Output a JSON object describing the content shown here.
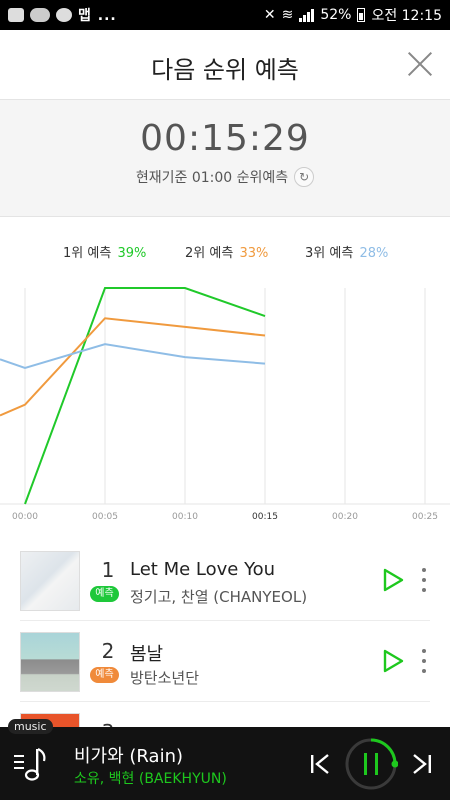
{
  "status_bar": {
    "left_text": "맵 ...",
    "battery": "52%",
    "time": "오전 12:15"
  },
  "header": {
    "title": "다음 순위 예측",
    "close_icon": "close-icon"
  },
  "timer": {
    "time": "00:15:29",
    "subtitle": "현재기준 01:00 순위예측"
  },
  "legend": [
    {
      "label": "1위 예측",
      "pct": "39%",
      "color": "#20c92a"
    },
    {
      "label": "2위 예측",
      "pct": "33%",
      "color": "#f09a3e"
    },
    {
      "label": "3위 예측",
      "pct": "28%",
      "color": "#8fbde6"
    }
  ],
  "chart_data": {
    "type": "line",
    "x": [
      "00:00",
      "00:05",
      "00:10",
      "00:15",
      "00:20",
      "00:25"
    ],
    "ylim": [
      0,
      100
    ],
    "grid": true,
    "series": [
      {
        "name": "1위 예측",
        "color": "#20c92a",
        "values": [
          0,
          100,
          100,
          87,
          null,
          null
        ],
        "start_value": null
      },
      {
        "name": "2위 예측",
        "color": "#f09a3e",
        "values": [
          46,
          86,
          82,
          78,
          null,
          null
        ],
        "start_value": 41
      },
      {
        "name": "3위 예측",
        "color": "#8fbde6",
        "values": [
          63,
          74,
          68,
          65,
          null,
          null
        ],
        "start_value": 67
      }
    ],
    "highlight_tick": "00:15"
  },
  "songs": [
    {
      "rank": "1",
      "badge": "예측",
      "badge_color": "#1ec83a",
      "title": "Let Me Love You",
      "artist": "정기고, 찬열 (CHANYEOL)"
    },
    {
      "rank": "2",
      "badge": "예측",
      "badge_color": "#f08a3a",
      "title": "봄날",
      "artist": "방탄소년단"
    },
    {
      "rank": "3",
      "badge": "",
      "badge_color": "#888888",
      "title": "",
      "artist": ""
    }
  ],
  "player": {
    "tag": "music",
    "title": "비가와 (Rain)",
    "artist": "소유, 백현 (BAEKHYUN)",
    "accent": "#1ec81e"
  }
}
